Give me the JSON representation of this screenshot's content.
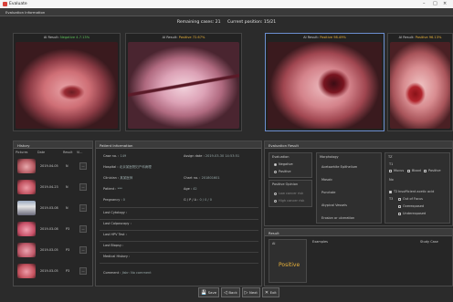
{
  "window": {
    "title": "Evaluate",
    "controls": [
      "–",
      "□",
      "×"
    ]
  },
  "menubar": {
    "label": "Evaluation Information"
  },
  "status": {
    "remaining": "Remaining cases: 21",
    "position": "Current position: 15/21"
  },
  "thumbnails": [
    {
      "prefix": "AI Result:",
      "label": "Negative",
      "score": "4.7.13%",
      "state": "neg"
    },
    {
      "prefix": "AI Result:",
      "label": "Positive",
      "score": "72.67%",
      "state": "pos"
    },
    {
      "prefix": "AI Result:",
      "label": "Positive",
      "score": "98.49%",
      "state": "pos"
    },
    {
      "prefix": "AI Result:",
      "label": "Positive",
      "score": "96.13%",
      "state": "pos"
    }
  ],
  "history": {
    "title": "History",
    "columns": [
      "Pictures",
      "Date",
      "Result",
      "Vi..."
    ],
    "rows": [
      {
        "date": "2019-04-05",
        "result": "N",
        "v": "..."
      },
      {
        "date": "2019-04-23",
        "result": "N",
        "v": "..."
      },
      {
        "date": "2019-03-08",
        "result": "N",
        "v": "..."
      },
      {
        "date": "2019-03-08",
        "result": "P3",
        "v": "..."
      },
      {
        "date": "2019-03-05",
        "result": "P3",
        "v": "..."
      },
      {
        "date": "2019-03-05",
        "result": "P3",
        "v": "..."
      }
    ]
  },
  "patient": {
    "title": "Patient Information",
    "case_no_label": "Case no. :",
    "case_no": "149",
    "assign_date_label": "Assign date :",
    "assign_date": "2019-03-30 14:53:51",
    "hospital_label": "Hospital :",
    "hospital": "北京某医院妇产科病理",
    "clinician_label": "Clinician :",
    "clinician": "某某医师",
    "chart_no_label": "Chart no. :",
    "chart_no": "201801601",
    "patient_label": "Patient :",
    "patient": "***",
    "age_label": "Age :",
    "age": "42",
    "pregnancy_label": "Pregnancy :",
    "pregnancy": "0",
    "gpa_label": "G / P / A :",
    "gpa": "0 / 0 / 0",
    "cytology": "Last Cytology :",
    "colposcopy": "Last Colposcopy :",
    "hpv": "Last HPV Test :",
    "biopsy": "Last Biopsy :",
    "history": "Medical History :",
    "comment_label": "Comment :",
    "comment": "Jiskr: No comment"
  },
  "evaluation": {
    "title": "Evaluation Result",
    "evaluation_head": "Evaluation",
    "opt_negative": "Negative",
    "opt_positive": "Positive",
    "positive_opinion": "Positive Opinion",
    "opt_low": "Low cancer risk",
    "opt_high": "High cancer risk",
    "morphology": "Morphology",
    "acetowhite": "Acetowhite Epithelium",
    "mosaic": "Mosaic",
    "punctate": "Punctate",
    "atypical": "Atypical Vessels",
    "erosion": "Erosion or ulceration",
    "tz": "TZ",
    "tz1": "T1",
    "mucus": "Mucus",
    "blood": "Blood",
    "positive_chk": "Positive",
    "no": "No",
    "t2": "T2",
    "insufficient": "Insufficient acetic acid",
    "t3": "T3",
    "out_of_focus": "Out of Focus",
    "overexposed": "Overexposed",
    "underexposed": "Underexposed"
  },
  "result": {
    "title": "Result",
    "ai_label": "AI",
    "ai_value": "Positive",
    "examples": "Examples",
    "study_case": "Study Case"
  },
  "buttons": [
    {
      "icon": "save-icon",
      "glyph": "💾",
      "label": "Save"
    },
    {
      "icon": "back-icon",
      "glyph": "◁",
      "label": "Back"
    },
    {
      "icon": "next-icon",
      "glyph": "▷",
      "label": "Next"
    },
    {
      "icon": "exit-icon",
      "glyph": "✕",
      "label": "Exit"
    }
  ]
}
